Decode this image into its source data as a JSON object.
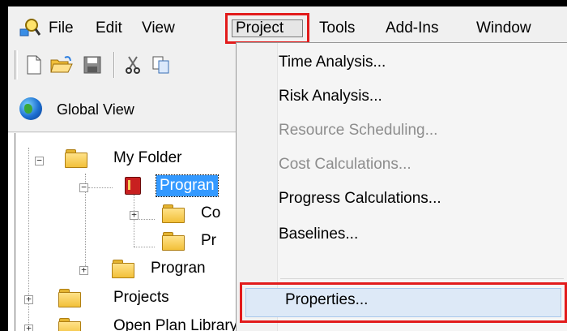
{
  "menubar": {
    "items": [
      "File",
      "Edit",
      "View",
      "Project",
      "Tools",
      "Add-Ins",
      "Window"
    ],
    "active": "Project"
  },
  "toolbar": {
    "buttons": [
      "new-document-icon",
      "open-folder-icon",
      "save-icon",
      "cut-icon",
      "copy-icon"
    ]
  },
  "view_bar": {
    "label": "Global View",
    "icon": "globe-icon"
  },
  "tree": {
    "items": [
      {
        "label": "My Folder"
      },
      {
        "label": "Progran"
      },
      {
        "label": "Co"
      },
      {
        "label": "Pr"
      },
      {
        "label": "Progran"
      },
      {
        "label": "Projects"
      },
      {
        "label": "Open Plan Library"
      }
    ]
  },
  "project_menu": {
    "items": [
      {
        "label": "Time Analysis...",
        "enabled": true
      },
      {
        "label": "Risk Analysis...",
        "enabled": true
      },
      {
        "label": "Resource Scheduling...",
        "enabled": false
      },
      {
        "label": "Cost Calculations...",
        "enabled": false
      },
      {
        "label": "Progress Calculations...",
        "enabled": true
      },
      {
        "label": "Baselines...",
        "enabled": true
      },
      {
        "label": "Properties...",
        "enabled": true
      }
    ],
    "highlighted": "Properties..."
  },
  "colors": {
    "highlight_box": "#e21b1b",
    "selection": "#3399ff",
    "disabled_text": "#8d8d8d"
  }
}
